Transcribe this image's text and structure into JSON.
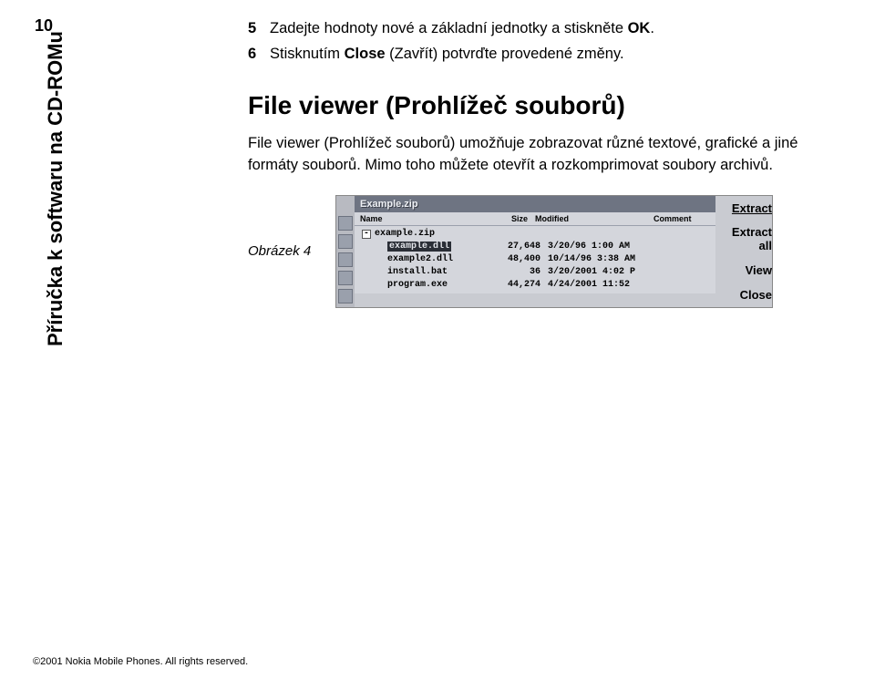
{
  "page_number": "10",
  "sidebar_title": "Příručka k softwaru na CD-ROMu",
  "steps": [
    {
      "num": "5",
      "text_pre": "Zadejte hodnoty nové a základní jednotky a stiskněte ",
      "bold": "OK",
      "text_post": "."
    },
    {
      "num": "6",
      "text_pre": "Stisknutím ",
      "bold": "Close",
      "text_mid": " (Zavřít) potvrďte provedené změny."
    }
  ],
  "heading": "File viewer (Prohlížeč souborů)",
  "paragraph": "File viewer (Prohlížeč souborů) umožňuje zobrazovat různé textové, grafické a jiné formáty souborů. Mimo toho můžete otevřít a rozkomprimovat soubory archivů.",
  "figure_label": "Obrázek 4",
  "screenshot": {
    "title": "Example.zip",
    "headers": {
      "name": "Name",
      "size": "Size",
      "modified": "Modified",
      "comment": "Comment"
    },
    "rows": [
      {
        "name": "example.zip",
        "size": "",
        "mod": "",
        "icon": "minus"
      },
      {
        "name_sel": "example.dll",
        "size": "27,648",
        "mod": "3/20/96 1:00 AM",
        "indent": true
      },
      {
        "name": "example2.dll",
        "size": "48,400",
        "mod": "10/14/96 3:38 AM",
        "indent": true
      },
      {
        "name": "install.bat",
        "size": "36",
        "mod": "3/20/2001 4:02 P",
        "indent": true
      },
      {
        "name": "program.exe",
        "size": "44,274",
        "mod": "4/24/2001 11:52",
        "indent": true
      }
    ],
    "buttons": [
      "Extract",
      "Extract all",
      "View",
      "Close"
    ]
  },
  "footer_copyright": "©2001 Nokia Mobile Phones. All rights reserved."
}
